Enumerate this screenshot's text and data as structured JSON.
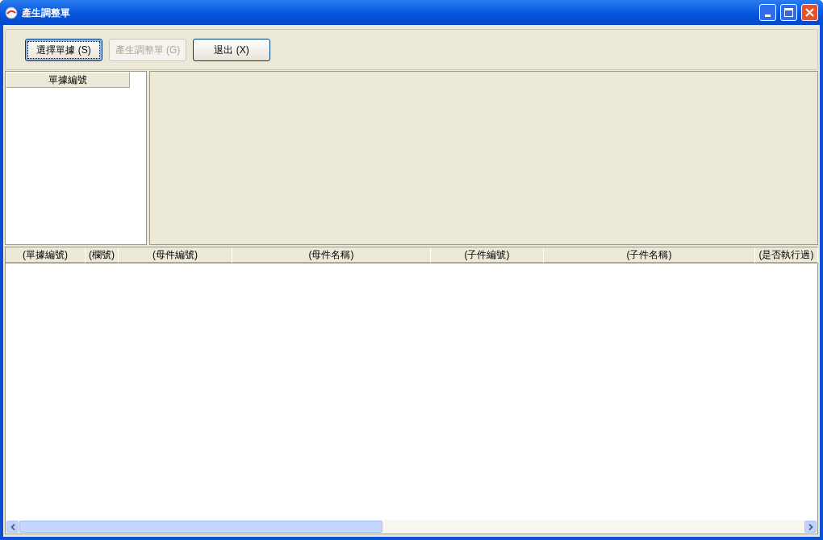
{
  "window": {
    "title": "產生調整單"
  },
  "toolbar": {
    "buttons": [
      {
        "label": "選擇單據 (S)",
        "disabled": false,
        "focused": true
      },
      {
        "label": "產生調整單 (G)",
        "disabled": true,
        "focused": false
      },
      {
        "label": "退出 (X)",
        "disabled": false,
        "focused": false
      }
    ]
  },
  "document_list": {
    "columns": [
      "單據編號"
    ]
  },
  "detail_table": {
    "columns": [
      "(單據編號)",
      "(欄號)",
      "(母件編號)",
      "(母件名稱)",
      "(子件編號)",
      "(子件名稱)",
      "(是否執行過)"
    ]
  }
}
